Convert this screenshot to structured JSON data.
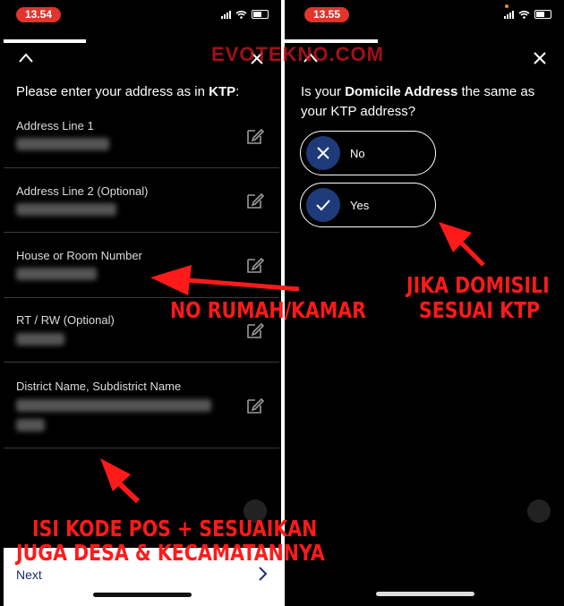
{
  "watermark": "EVOTEKNO.COM",
  "left_screen": {
    "status_time": "13.54",
    "prompt_prefix": "Please enter your address as in ",
    "prompt_bold": "KTP",
    "prompt_suffix": ":",
    "fields": [
      {
        "label": "Address Line 1"
      },
      {
        "label": "Address Line 2 (Optional)"
      },
      {
        "label": "House or Room Number"
      },
      {
        "label": "RT / RW (Optional)"
      },
      {
        "label": "District Name, Subdistrict Name"
      }
    ],
    "next_label": "Next"
  },
  "right_screen": {
    "status_time": "13.55",
    "prompt_part1": "Is your ",
    "prompt_bold": "Domicile Address",
    "prompt_part2": " the same as your KTP address?",
    "options": [
      {
        "label": "No",
        "icon": "x-icon"
      },
      {
        "label": "Yes",
        "icon": "check-icon"
      }
    ]
  },
  "annotations": {
    "no_rumah": "NO RUMAH/KAMAR",
    "jika_line1": "JIKA DOMISILI",
    "jika_line2": "SESUAI KTP",
    "isi_line1": "ISI KODE POS + SESUAIKAN",
    "isi_line2": "JUGA DESA & KECAMATANNYA"
  },
  "colors": {
    "annotation": "#ff1a1a",
    "status_pill": "#e0342c",
    "option_icon_bg": "#1e3a78",
    "next_text": "#1a2e6e"
  }
}
